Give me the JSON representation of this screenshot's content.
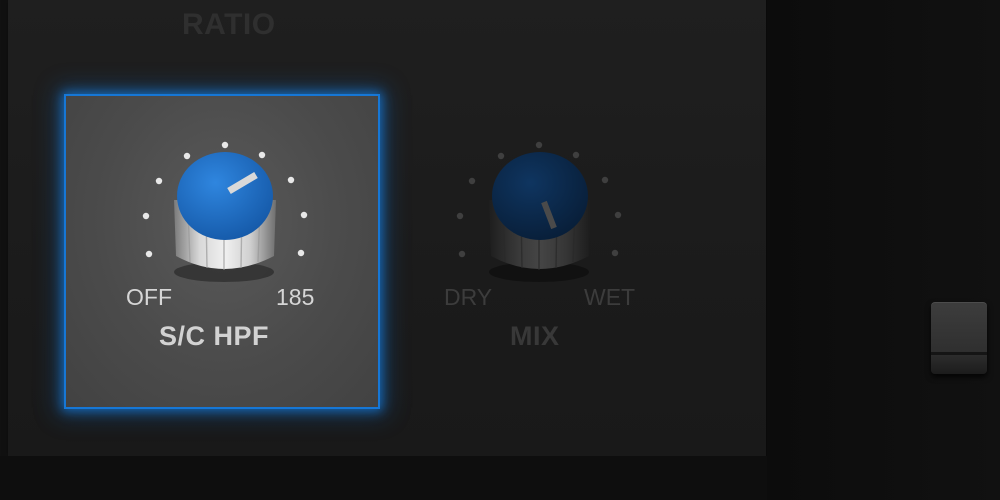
{
  "header": {
    "ratio_label": "RATIO"
  },
  "sc_hpf": {
    "title": "S/C HPF",
    "min_label": "OFF",
    "max_label": "185",
    "knob_color": "#1a6fc9",
    "highlight_color": "#1677d6",
    "selected": true
  },
  "mix": {
    "title": "MIX",
    "min_label": "DRY",
    "max_label": "WET",
    "knob_color": "#0b2a4d"
  },
  "icons": {
    "hpf_knob": "rotary-knob-icon",
    "mix_knob": "rotary-knob-icon",
    "fader": "fader-handle-icon"
  }
}
